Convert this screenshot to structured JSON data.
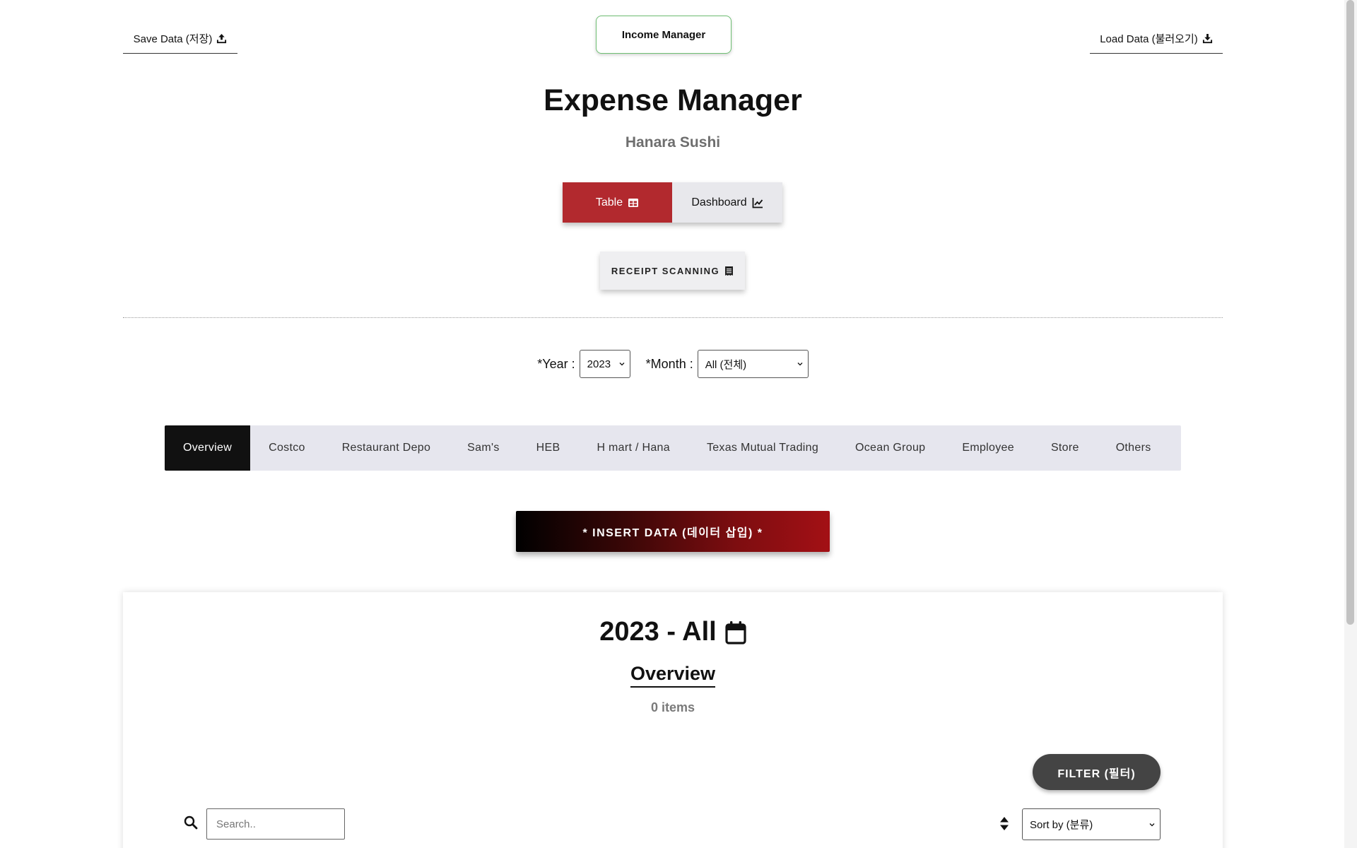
{
  "header": {
    "save_label": "Save Data (저장)",
    "save_icon": "upload-icon",
    "income_label": "Income Manager",
    "load_label": "Load Data (불러오기)",
    "load_icon": "download-icon"
  },
  "page": {
    "title": "Expense Manager",
    "subtitle": "Hanara Sushi"
  },
  "view_toggle": {
    "table_label": "Table",
    "table_icon": "table-icon",
    "dashboard_label": "Dashboard",
    "dashboard_icon": "line-chart-icon",
    "active": "Table"
  },
  "receipt": {
    "label": "RECEIPT SCANNING",
    "icon": "receipt-icon"
  },
  "filters": {
    "year_label": "*Year :",
    "year_value": "2023",
    "month_label": "*Month :",
    "month_value": "All (전체)"
  },
  "tabs": [
    {
      "label": "Overview",
      "active": true
    },
    {
      "label": "Costco"
    },
    {
      "label": "Restaurant Depo"
    },
    {
      "label": "Sam's"
    },
    {
      "label": "HEB"
    },
    {
      "label": "H mart / Hana"
    },
    {
      "label": "Texas Mutual Trading"
    },
    {
      "label": "Ocean Group"
    },
    {
      "label": "Employee"
    },
    {
      "label": "Store"
    },
    {
      "label": "Others"
    }
  ],
  "insert": {
    "label": "* INSERT DATA (데이터 삽입) *"
  },
  "card": {
    "title": "2023 - All",
    "title_icon": "calendar-icon",
    "section": "Overview",
    "count": "0 items",
    "filter_label": "FILTER (필터)",
    "search_placeholder": "Search..",
    "sort_value": "Sort by (분류)"
  },
  "colors": {
    "accent_red": "#b2292e",
    "income_border": "#6fbf73",
    "tab_bar": "#e6e6ee",
    "active_tab": "#111111",
    "filter_button": "#444444"
  }
}
